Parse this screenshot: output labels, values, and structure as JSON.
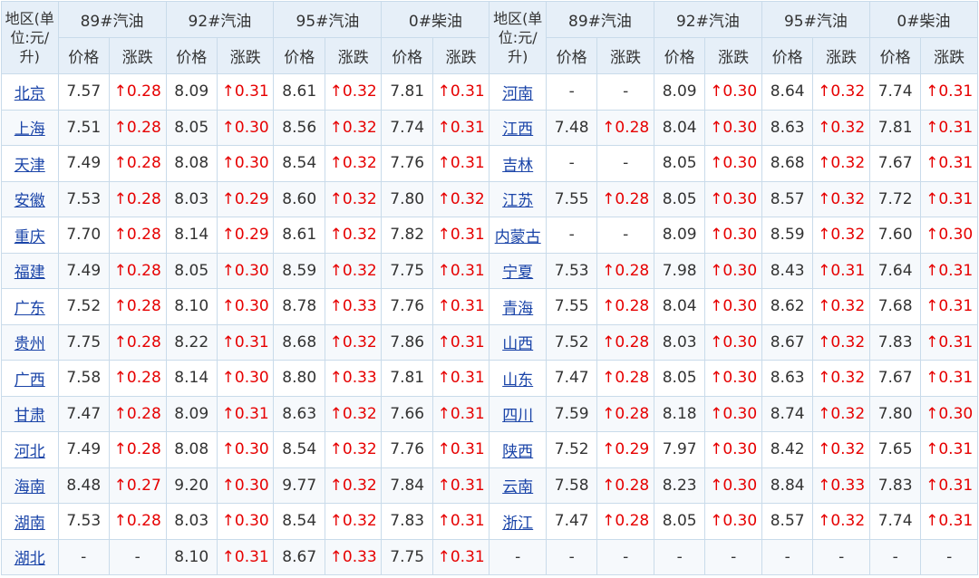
{
  "header": {
    "region": "地区(单位:元/升)",
    "fuels": [
      "89#汽油",
      "92#汽油",
      "95#汽油",
      "0#柴油"
    ],
    "price": "价格",
    "change": "涨跌"
  },
  "rows": [
    [
      {
        "name": "北京",
        "v": [
          [
            "7.57",
            "↑0.28"
          ],
          [
            "8.09",
            "↑0.31"
          ],
          [
            "8.61",
            "↑0.32"
          ],
          [
            "7.81",
            "↑0.31"
          ]
        ]
      },
      {
        "name": "河南",
        "v": [
          [
            "-",
            "-"
          ],
          [
            "8.09",
            "↑0.30"
          ],
          [
            "8.64",
            "↑0.32"
          ],
          [
            "7.74",
            "↑0.31"
          ]
        ]
      }
    ],
    [
      {
        "name": "上海",
        "v": [
          [
            "7.51",
            "↑0.28"
          ],
          [
            "8.05",
            "↑0.30"
          ],
          [
            "8.56",
            "↑0.32"
          ],
          [
            "7.74",
            "↑0.31"
          ]
        ]
      },
      {
        "name": "江西",
        "v": [
          [
            "7.48",
            "↑0.28"
          ],
          [
            "8.04",
            "↑0.30"
          ],
          [
            "8.63",
            "↑0.32"
          ],
          [
            "7.81",
            "↑0.31"
          ]
        ]
      }
    ],
    [
      {
        "name": "天津",
        "v": [
          [
            "7.49",
            "↑0.28"
          ],
          [
            "8.08",
            "↑0.30"
          ],
          [
            "8.54",
            "↑0.32"
          ],
          [
            "7.76",
            "↑0.31"
          ]
        ]
      },
      {
        "name": "吉林",
        "v": [
          [
            "-",
            "-"
          ],
          [
            "8.05",
            "↑0.30"
          ],
          [
            "8.68",
            "↑0.32"
          ],
          [
            "7.67",
            "↑0.31"
          ]
        ]
      }
    ],
    [
      {
        "name": "安徽",
        "v": [
          [
            "7.53",
            "↑0.28"
          ],
          [
            "8.03",
            "↑0.29"
          ],
          [
            "8.60",
            "↑0.32"
          ],
          [
            "7.80",
            "↑0.32"
          ]
        ]
      },
      {
        "name": "江苏",
        "v": [
          [
            "7.55",
            "↑0.28"
          ],
          [
            "8.05",
            "↑0.30"
          ],
          [
            "8.57",
            "↑0.32"
          ],
          [
            "7.72",
            "↑0.31"
          ]
        ]
      }
    ],
    [
      {
        "name": "重庆",
        "v": [
          [
            "7.70",
            "↑0.28"
          ],
          [
            "8.14",
            "↑0.29"
          ],
          [
            "8.61",
            "↑0.32"
          ],
          [
            "7.82",
            "↑0.31"
          ]
        ]
      },
      {
        "name": "内蒙古",
        "v": [
          [
            "-",
            "-"
          ],
          [
            "8.09",
            "↑0.30"
          ],
          [
            "8.59",
            "↑0.32"
          ],
          [
            "7.60",
            "↑0.30"
          ]
        ]
      }
    ],
    [
      {
        "name": "福建",
        "v": [
          [
            "7.49",
            "↑0.28"
          ],
          [
            "8.05",
            "↑0.30"
          ],
          [
            "8.59",
            "↑0.32"
          ],
          [
            "7.75",
            "↑0.31"
          ]
        ]
      },
      {
        "name": "宁夏",
        "v": [
          [
            "7.53",
            "↑0.28"
          ],
          [
            "7.98",
            "↑0.30"
          ],
          [
            "8.43",
            "↑0.31"
          ],
          [
            "7.64",
            "↑0.31"
          ]
        ]
      }
    ],
    [
      {
        "name": "广东",
        "v": [
          [
            "7.52",
            "↑0.28"
          ],
          [
            "8.10",
            "↑0.30"
          ],
          [
            "8.78",
            "↑0.33"
          ],
          [
            "7.76",
            "↑0.31"
          ]
        ]
      },
      {
        "name": "青海",
        "v": [
          [
            "7.55",
            "↑0.28"
          ],
          [
            "8.04",
            "↑0.30"
          ],
          [
            "8.62",
            "↑0.32"
          ],
          [
            "7.68",
            "↑0.31"
          ]
        ]
      }
    ],
    [
      {
        "name": "贵州",
        "v": [
          [
            "7.75",
            "↑0.28"
          ],
          [
            "8.22",
            "↑0.31"
          ],
          [
            "8.68",
            "↑0.32"
          ],
          [
            "7.86",
            "↑0.31"
          ]
        ]
      },
      {
        "name": "山西",
        "v": [
          [
            "7.52",
            "↑0.28"
          ],
          [
            "8.03",
            "↑0.30"
          ],
          [
            "8.67",
            "↑0.32"
          ],
          [
            "7.83",
            "↑0.31"
          ]
        ]
      }
    ],
    [
      {
        "name": "广西",
        "v": [
          [
            "7.58",
            "↑0.28"
          ],
          [
            "8.14",
            "↑0.30"
          ],
          [
            "8.80",
            "↑0.33"
          ],
          [
            "7.81",
            "↑0.31"
          ]
        ]
      },
      {
        "name": "山东",
        "v": [
          [
            "7.47",
            "↑0.28"
          ],
          [
            "8.05",
            "↑0.30"
          ],
          [
            "8.63",
            "↑0.32"
          ],
          [
            "7.67",
            "↑0.31"
          ]
        ]
      }
    ],
    [
      {
        "name": "甘肃",
        "v": [
          [
            "7.47",
            "↑0.28"
          ],
          [
            "8.09",
            "↑0.31"
          ],
          [
            "8.63",
            "↑0.32"
          ],
          [
            "7.66",
            "↑0.31"
          ]
        ]
      },
      {
        "name": "四川",
        "v": [
          [
            "7.59",
            "↑0.28"
          ],
          [
            "8.18",
            "↑0.30"
          ],
          [
            "8.74",
            "↑0.32"
          ],
          [
            "7.80",
            "↑0.30"
          ]
        ]
      }
    ],
    [
      {
        "name": "河北",
        "v": [
          [
            "7.49",
            "↑0.28"
          ],
          [
            "8.08",
            "↑0.30"
          ],
          [
            "8.54",
            "↑0.32"
          ],
          [
            "7.76",
            "↑0.31"
          ]
        ]
      },
      {
        "name": "陕西",
        "v": [
          [
            "7.52",
            "↑0.29"
          ],
          [
            "7.97",
            "↑0.30"
          ],
          [
            "8.42",
            "↑0.32"
          ],
          [
            "7.65",
            "↑0.31"
          ]
        ]
      }
    ],
    [
      {
        "name": "海南",
        "v": [
          [
            "8.48",
            "↑0.27"
          ],
          [
            "9.20",
            "↑0.30"
          ],
          [
            "9.77",
            "↑0.32"
          ],
          [
            "7.84",
            "↑0.31"
          ]
        ]
      },
      {
        "name": "云南",
        "v": [
          [
            "7.58",
            "↑0.28"
          ],
          [
            "8.23",
            "↑0.30"
          ],
          [
            "8.84",
            "↑0.33"
          ],
          [
            "7.83",
            "↑0.31"
          ]
        ]
      }
    ],
    [
      {
        "name": "湖南",
        "v": [
          [
            "7.53",
            "↑0.28"
          ],
          [
            "8.03",
            "↑0.30"
          ],
          [
            "8.54",
            "↑0.32"
          ],
          [
            "7.83",
            "↑0.31"
          ]
        ]
      },
      {
        "name": "浙江",
        "v": [
          [
            "7.47",
            "↑0.28"
          ],
          [
            "8.05",
            "↑0.30"
          ],
          [
            "8.57",
            "↑0.32"
          ],
          [
            "7.74",
            "↑0.31"
          ]
        ]
      }
    ],
    [
      {
        "name": "湖北",
        "v": [
          [
            "-",
            "-"
          ],
          [
            "8.10",
            "↑0.31"
          ],
          [
            "8.67",
            "↑0.33"
          ],
          [
            "7.75",
            "↑0.31"
          ]
        ]
      },
      {
        "name": "-",
        "v": [
          [
            "-",
            "-"
          ],
          [
            "-",
            "-"
          ],
          [
            "-",
            "-"
          ],
          [
            "-",
            "-"
          ]
        ]
      }
    ]
  ],
  "colors": {
    "header_bg": "#e6eff8",
    "border": "#c9dbea",
    "link": "#1a44a8",
    "rise": "#e60000"
  }
}
